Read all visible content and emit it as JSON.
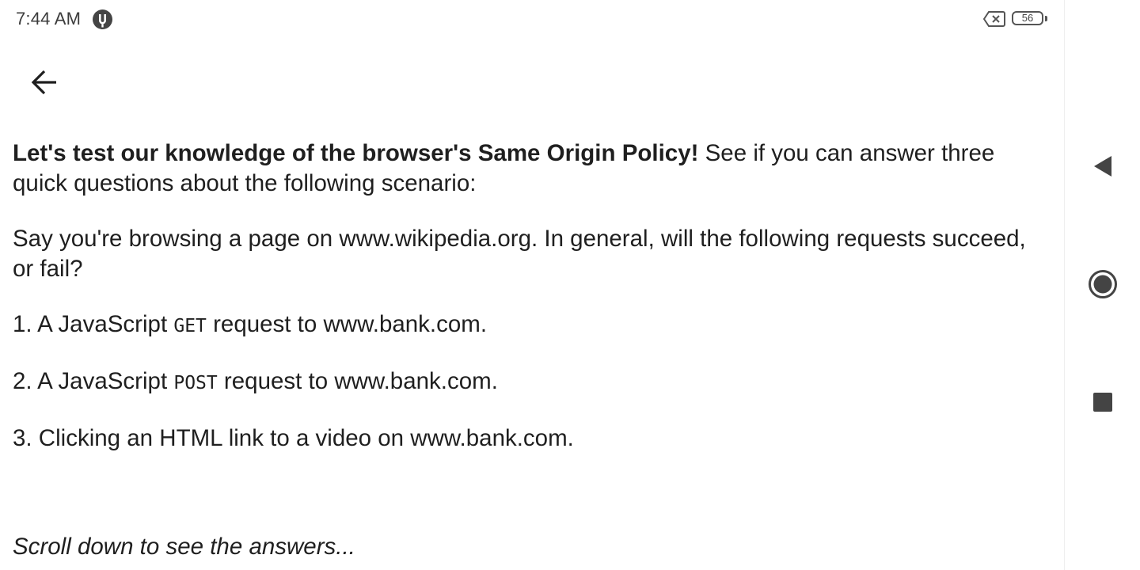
{
  "status_bar": {
    "time": "7:44 AM",
    "battery_level": "56",
    "app_icon": "vpn-icon",
    "notification_icon": "data-off-icon"
  },
  "header": {
    "back_icon": "arrow-left-icon"
  },
  "article": {
    "intro_bold": "Let's test our knowledge of the browser's Same Origin Policy!",
    "intro_rest": " See if you can answer three quick questions about the following scenario:",
    "scenario": "Say you're browsing a page on www.wikipedia.org. In general, will the following requests succeed, or fail?",
    "q1_prefix": "1. A JavaScript ",
    "q1_code": "GET",
    "q1_suffix": " request to www.bank.com.",
    "q2_prefix": "2. A JavaScript ",
    "q2_code": "POST",
    "q2_suffix": " request to www.bank.com.",
    "q3": "3. Clicking an HTML link to a video on www.bank.com.",
    "footer": "Scroll down to see the answers..."
  },
  "nav_bar": {
    "back_icon": "triangle-back-icon",
    "home_icon": "circle-home-icon",
    "recents_icon": "square-recents-icon"
  }
}
